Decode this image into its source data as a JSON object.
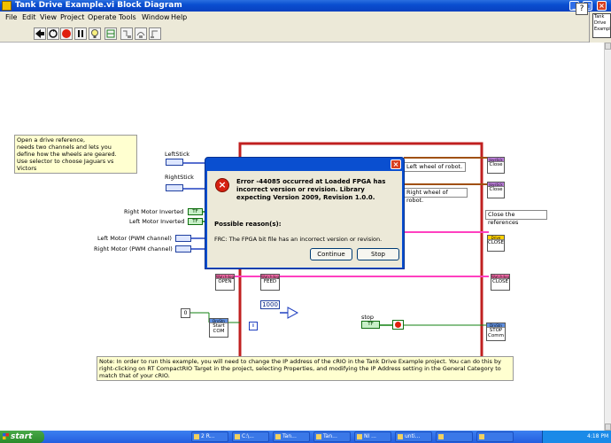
{
  "window": {
    "title": "Tank Drive Example.vi Block Diagram"
  },
  "menu": [
    "File",
    "Edit",
    "View",
    "Project",
    "Operate",
    "Tools",
    "Window",
    "Help"
  ],
  "toolbar": {
    "buttons": [
      "run-arrow-icon",
      "run-continuously-icon",
      "abort-icon",
      "pause-icon",
      "highlight-execution-icon",
      "retain-wire-values-icon",
      "step-into-icon",
      "step-over-icon",
      "step-out-icon"
    ]
  },
  "context_help": {
    "title": "Tank Drive Example"
  },
  "notes": {
    "top": "Open a drive reference,\nneeds two channels and lets you\ndefine how the wheels are geared.\nUse selector to choose Jaguars vs Victors",
    "bottom": "Note:  In order to run this example, you will need to change the IP address of the cRIO in the Tank Drive Example project.  You can do this by right-clicking on RT CompactRIO Target in the project, selecting Properties, and modifying the IP Address setting in the General Category to match that of your cRIO."
  },
  "labels": {
    "left_stick": "LeftStick",
    "right_stick": "RightStick",
    "right_motor_inverted": "Right Motor Inverted",
    "left_motor_inverted": "Left Motor Inverted",
    "left_motor_pwm": "Left Motor (PWM channel)",
    "right_motor_pwm": "Right Motor (PWM channel)",
    "left_wheel": "Left wheel of robot.",
    "right_wheel": "Right wheel of robot.",
    "close_refs": "Close the references",
    "stop": "stop",
    "timer_value": "1000",
    "tf": "TF",
    "info": "i"
  },
  "nodes": {
    "open": "OPEN",
    "feed": "FEED",
    "close_watchdog": "CLOSE",
    "close_drive": "CLOSE",
    "close_js1": "Close",
    "close_js2": "Close",
    "start_comm": "Start COM",
    "stop_comm": "STOP Comm",
    "drive_hdr": "Drive",
    "watchdog_hdr": "Watchdog",
    "joystick_hdr": "Joystick",
    "drvstn_hdr": "DrvStn"
  },
  "dialog": {
    "message": "Error -44085 occurred at Loaded FPGA has incorrect version or revision.  Library expecting Version 2009, Revision 1.0.0.",
    "reason_heading": "Possible reason(s):",
    "reason": "FRC:  The FPGA bit file has an incorrect version or revision.",
    "continue_label": "Continue",
    "stop_label": "Stop"
  },
  "taskbar": {
    "start_label": "start",
    "tasks": [
      "2 R...",
      "C:\\...",
      "Tan...",
      "Tan...",
      "NI ...",
      "unti...",
      "",
      ""
    ],
    "clock": "4:18 PM"
  },
  "colors": {
    "loop_border": "#c02020",
    "wire_pink": "#ff40c0",
    "wire_green": "#108010",
    "wire_blue": "#2040c0",
    "wire_brown": "#a05010"
  }
}
